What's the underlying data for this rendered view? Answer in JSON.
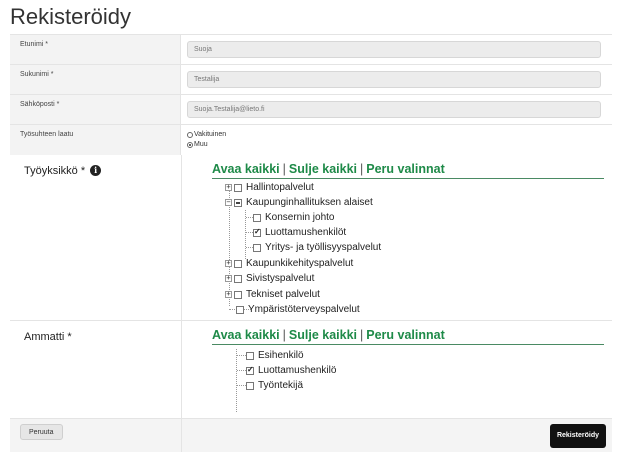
{
  "page": {
    "title": "Rekisteröidy"
  },
  "fields": {
    "first_name": {
      "label": "Etunimi *",
      "value": "Suoja"
    },
    "last_name": {
      "label": "Sukunimi *",
      "value": "Testalija"
    },
    "email": {
      "label": "Sähköposti *",
      "value": "Suoja.Testalija@lieto.fi"
    },
    "employment": {
      "label": "Työsuhteen laatu",
      "options": [
        {
          "label": "Vakituinen",
          "selected": false
        },
        {
          "label": "Muu",
          "selected": true
        }
      ]
    }
  },
  "unit_section": {
    "label": "Työyksikkö *",
    "info_icon": "info-icon",
    "actions": {
      "open_all": "Avaa kaikki",
      "close_all": "Sulje kaikki",
      "clear": "Peru valinnat",
      "separator": "|"
    },
    "nodes": [
      {
        "label": "Hallintopalvelut",
        "expander": "+",
        "checked": "none"
      },
      {
        "label": "Kaupunginhallituksen alaiset",
        "expander": "−",
        "checked": "partial"
      },
      {
        "label": "Konsernin johto",
        "checked": "none"
      },
      {
        "label": "Luottamushenkilöt",
        "checked": "checked"
      },
      {
        "label": "Yritys- ja työllisyyspalvelut",
        "checked": "none"
      },
      {
        "label": "Kaupunkikehityspalvelut",
        "expander": "+",
        "checked": "none"
      },
      {
        "label": "Sivistyspalvelut",
        "expander": "+",
        "checked": "none"
      },
      {
        "label": "Tekniset palvelut",
        "expander": "+",
        "checked": "none"
      },
      {
        "label": "Ympäristöterveyspalvelut",
        "checked": "none"
      }
    ]
  },
  "profession_section": {
    "label": "Ammatti *",
    "actions": {
      "open_all": "Avaa kaikki",
      "close_all": "Sulje kaikki",
      "clear": "Peru valinnat",
      "separator": "|"
    },
    "nodes": [
      {
        "label": "Esihenkilö",
        "checked": "none"
      },
      {
        "label": "Luottamushenkilö",
        "checked": "checked"
      },
      {
        "label": "Työntekijä",
        "checked": "none"
      }
    ]
  },
  "footer": {
    "cancel_label": "Peruuta",
    "submit_label": "Rekisteröidy"
  }
}
